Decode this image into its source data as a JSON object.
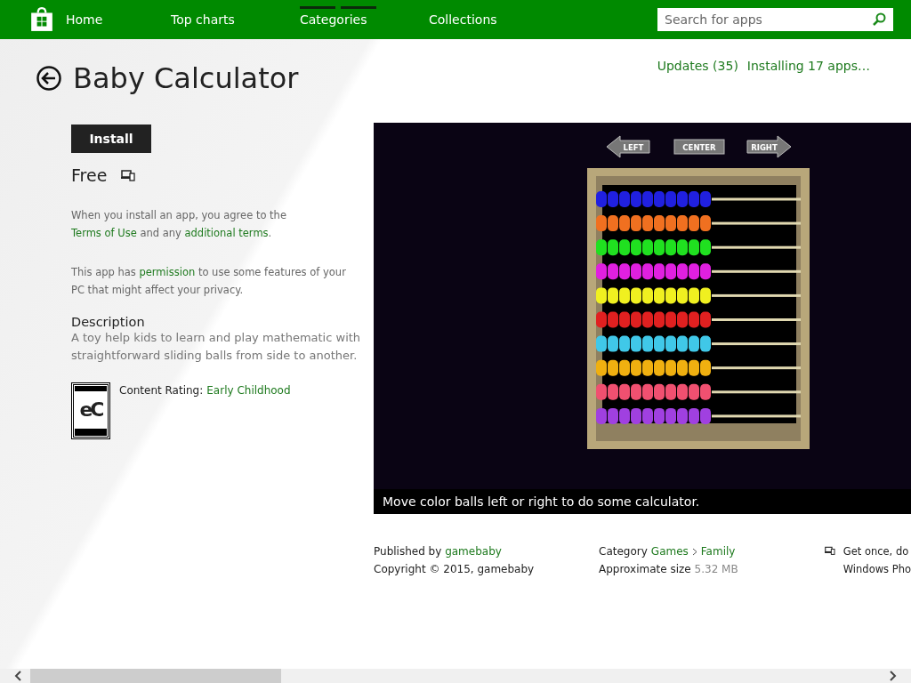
{
  "nav": {
    "tabs": [
      {
        "label": "Home",
        "selected": false
      },
      {
        "label": "Top charts",
        "selected": false
      },
      {
        "label": "Categories",
        "selected": true
      },
      {
        "label": "Collections",
        "selected": false
      }
    ],
    "search": {
      "placeholder": "Search for apps"
    }
  },
  "top_links": [
    "Updates (35)",
    "Installing 17 apps…"
  ],
  "app": {
    "title": "Baby Calculator",
    "install_button": "Install",
    "price": "Free",
    "terms": [
      {
        "text": "When you install an app, you agree to the ",
        "link": false
      },
      {
        "text": "Terms of Use",
        "link": true
      },
      {
        "text": " and any ",
        "link": false
      },
      {
        "text": "additional terms",
        "link": true
      },
      {
        "text": ".",
        "link": false
      }
    ],
    "permission": [
      {
        "text": "This app has ",
        "link": false
      },
      {
        "text": "permission",
        "link": true
      },
      {
        "text": " to use some features of your PC that might affect your privacy.",
        "link": false
      }
    ],
    "description": {
      "heading": "Description",
      "text": "A toy help kids to learn and play mathematic with straightforward sliding balls from side to another."
    },
    "rating": {
      "label": "Content Rating:",
      "value": "Early Childhood",
      "badge": {
        "mark": "eC"
      }
    }
  },
  "screenshot": {
    "buttons": [
      "LEFT",
      "CENTER",
      "RIGHT"
    ],
    "rows": [
      {
        "color": "#2020e0"
      },
      {
        "color": "#f07020"
      },
      {
        "color": "#20e020"
      },
      {
        "color": "#e020e0"
      },
      {
        "color": "#f0f020"
      },
      {
        "color": "#e02020"
      },
      {
        "color": "#40c8e8"
      },
      {
        "color": "#f0b010"
      },
      {
        "color": "#f05070"
      },
      {
        "color": "#a040e0"
      }
    ],
    "caption": "Move color balls left or right to do some calculator."
  },
  "details": {
    "publisher": {
      "label": "Published by",
      "value": "gamebaby"
    },
    "copyright": "Copyright © 2015, gamebaby",
    "category": {
      "label": "Category",
      "path": [
        "Games",
        "Family"
      ]
    },
    "size": {
      "label": "Approximate size",
      "value": "5.32 MB"
    },
    "devices": [
      "Get once, do",
      "Windows Pho"
    ]
  }
}
